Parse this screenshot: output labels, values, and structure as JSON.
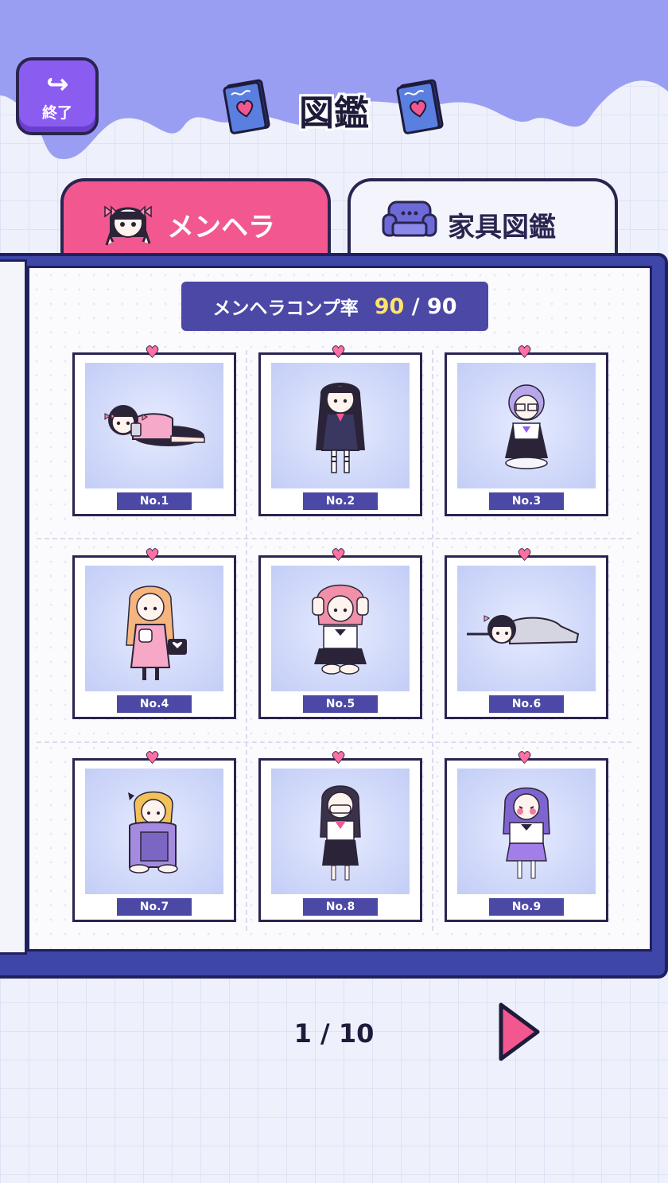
{
  "header": {
    "title": "図鑑",
    "exit_label": "終了",
    "exit_icon": "return-arrow-icon",
    "title_icon": "heart-book-icon"
  },
  "tabs": [
    {
      "label": "メンヘラ",
      "icon": "menhera-girl-icon",
      "active": true,
      "color": "#f2578f"
    },
    {
      "label": "家具図鑑",
      "icon": "sofa-icon",
      "active": false,
      "color": "#f4f5fc"
    }
  ],
  "completion": {
    "label": "メンヘラコンプ率",
    "current": "90",
    "separator": "/",
    "total": "90"
  },
  "cards": [
    {
      "label": "No.1",
      "pose": "lying-with-phone",
      "hair": "black",
      "outfit": "pink"
    },
    {
      "label": "No.2",
      "pose": "standing",
      "hair": "black twin-tails",
      "outfit": "navy dress"
    },
    {
      "label": "No.3",
      "pose": "sitting-glasses",
      "hair": "lavender",
      "outfit": "black dress"
    },
    {
      "label": "No.4",
      "pose": "standing-with-bag",
      "hair": "orange",
      "outfit": "pink dress"
    },
    {
      "label": "No.5",
      "pose": "sitting-hands-on-head",
      "hair": "pink",
      "outfit": "white and black"
    },
    {
      "label": "No.6",
      "pose": "lying-down",
      "hair": "black",
      "outfit": "grey"
    },
    {
      "label": "No.7",
      "pose": "hugging-knees",
      "hair": "blonde",
      "outfit": "purple"
    },
    {
      "label": "No.8",
      "pose": "standing-covering-face",
      "hair": "dark",
      "outfit": "sailor uniform"
    },
    {
      "label": "No.9",
      "pose": "standing-blushing",
      "hair": "purple",
      "outfit": "white and purple"
    }
  ],
  "pagination": {
    "current": "1",
    "separator": "/",
    "total": "10",
    "text": "1 / 10",
    "next_icon": "next-arrow-icon"
  },
  "colors": {
    "accent_pink": "#f2578f",
    "accent_purple": "#8b5cf0",
    "navy": "#4b48a6",
    "highlight_yellow": "#ffe46b"
  }
}
